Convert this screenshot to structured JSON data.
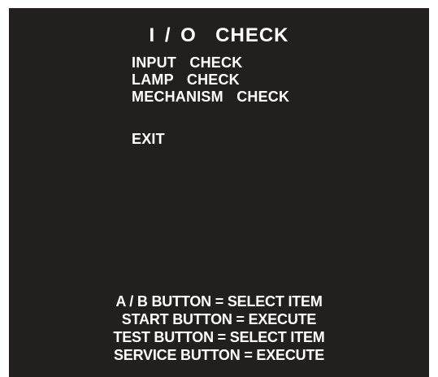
{
  "screen": {
    "title": "I / O  CHECK",
    "menu_items": [
      "INPUT  CHECK",
      "LAMP  CHECK",
      "MECHANISM  CHECK",
      "EXIT"
    ],
    "help_lines": [
      "A / B BUTTON = SELECT ITEM",
      "START BUTTON = EXECUTE",
      "TEST BUTTON = SELECT ITEM",
      "SERVICE BUTTON = EXECUTE"
    ]
  },
  "colors": {
    "background": "#221f1f",
    "text": "#ffffff",
    "page": "#ffffff"
  }
}
